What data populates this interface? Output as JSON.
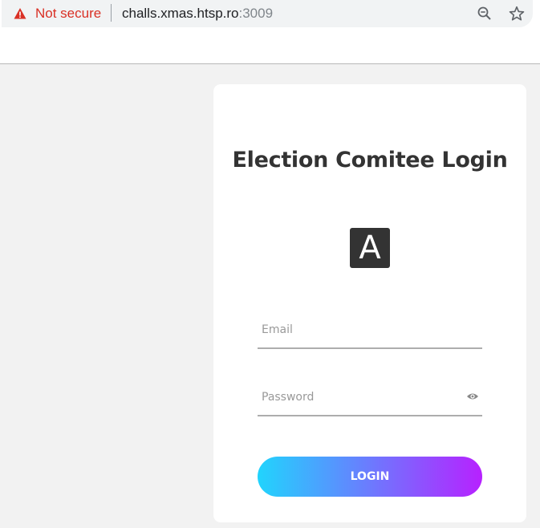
{
  "browser": {
    "security_label": "Not secure",
    "url_host": "challs.xmas.htsp.ro",
    "url_port": ":3009",
    "icons": {
      "warning": "warning-triangle-icon",
      "zoom": "zoom-out-icon",
      "bookmark": "star-icon"
    },
    "colors": {
      "security_label": "#d93025"
    }
  },
  "login": {
    "title": "Election Comitee Login",
    "logo_letter": "A",
    "email_placeholder": "Email",
    "password_placeholder": "Password",
    "password_toggle_icon": "eye-icon",
    "submit_label": "LOGIN",
    "colors": {
      "gradient_start": "#21d4fd",
      "gradient_end": "#b721ff",
      "title": "#333333"
    }
  }
}
